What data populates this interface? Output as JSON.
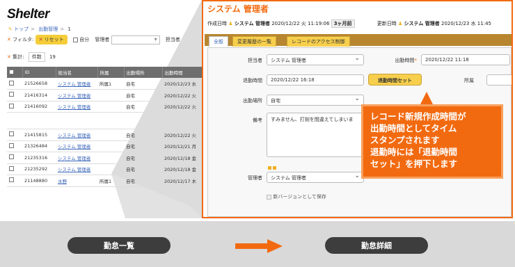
{
  "logo": "Shelter",
  "breadcrumb": [
    "トップ",
    "出勤管理",
    "1"
  ],
  "filter": {
    "label": "フィルタ:",
    "reset_label": "リセット",
    "self_label": "自分",
    "manager_label": "管理者",
    "owner_label": "担当者"
  },
  "summary": {
    "label": "集計:",
    "count_label": "件数",
    "count_value": "19"
  },
  "list": {
    "columns": [
      "ID",
      "担当名",
      "所属",
      "出勤場所",
      "出勤時間"
    ],
    "rows": [
      [
        "21526658",
        "システム 管理者",
        "所属1",
        "自宅",
        "2020/12/23 水"
      ],
      [
        "21416314",
        "システム 管理者",
        "",
        "自宅",
        "2020/12/22 火"
      ],
      [
        "21416092",
        "システム 管理者",
        "",
        "自宅",
        "2020/12/22 火"
      ],
      [
        "",
        "",
        "",
        "",
        ""
      ],
      [
        "21415815",
        "システム 管理者",
        "",
        "自宅",
        "2020/12/22 火"
      ],
      [
        "21326484",
        "システム 管理者",
        "",
        "自宅",
        "2020/12/21 月"
      ],
      [
        "21235316",
        "システム 管理者",
        "",
        "自宅",
        "2020/12/18 金"
      ],
      [
        "21235292",
        "システム 管理者",
        "",
        "自宅",
        "2020/12/18 金"
      ],
      [
        "21148880",
        "水野",
        "所属1",
        "自宅",
        "2020/12/17 木"
      ]
    ]
  },
  "detail": {
    "title": "システム 管理者",
    "created_label": "作成日時",
    "created_user": "システム 管理者",
    "created_time": "2020/12/22 火 11:19:06",
    "created_ago": "3ヶ月前",
    "updated_label": "更新日時",
    "updated_user": "システム 管理者",
    "updated_time": "2020/12/23 水 11:45",
    "tabs": [
      "全般",
      "変更履歴の一覧",
      "レコードのアクセス制御"
    ],
    "owner_label": "担当者",
    "owner_value": "システム 管理者",
    "checkin_label": "出勤時間",
    "checkin_value": "2020/12/22 11:18",
    "checkout_label": "退勤時間",
    "checkout_value": "2020/12/22 16:18",
    "set_checkout_button": "退勤時間セット",
    "dept_label": "所属",
    "place_label": "出勤場所",
    "place_value": "自宅",
    "memo_label": "備考",
    "memo_value": "すみません、打刻を間違えてしまいま",
    "manager_label": "管理者",
    "manager_value": "システム 管理者",
    "new_version_label": "新バージョンとして保存"
  },
  "callout": {
    "line1": "レコード新規作成時間が",
    "line2": "出勤時間としてタイム",
    "line3": "スタンプされます",
    "line4": "退勤時には「退勤時間",
    "line5": "セット」を押下します"
  },
  "bottom": {
    "left_label": "勤怠一覧",
    "right_label": "勤怠詳細"
  },
  "colors": {
    "accent": "#f26a10",
    "tab_bar": "#b8862f",
    "button_yellow": "#f7cf4c",
    "pill": "#3d3d3d"
  }
}
